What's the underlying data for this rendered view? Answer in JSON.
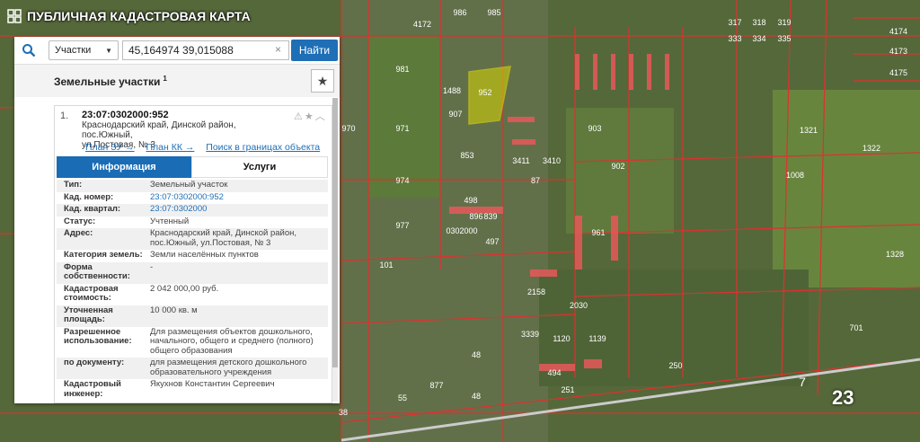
{
  "app": {
    "title": "ПУБЛИЧНАЯ КАДАСТРОВАЯ КАРТА"
  },
  "search": {
    "layer": "Участки",
    "value": "45,164974 39,015088",
    "clear": "×",
    "button": "Найти"
  },
  "panel": {
    "title": "Земельные участки",
    "count": "1",
    "fav_icon": "star-icon"
  },
  "result": {
    "index": "1.",
    "cad_number": "23:07:0302000:952",
    "address_l1": "Краснодарский край, Динской район, пос.Южный,",
    "address_l2": "ул.Постовая, № 3",
    "links": [
      "План ЗУ →",
      "План КК →",
      "Поиск в границах объекта →"
    ],
    "tabs": [
      "Информация",
      "Услуги"
    ],
    "props": [
      {
        "k": "Тип:",
        "v": "Земельный участок"
      },
      {
        "k": "Кад. номер:",
        "v": "23:07:0302000:952"
      },
      {
        "k": "Кад. квартал:",
        "v": "23:07:0302000"
      },
      {
        "k": "Статус:",
        "v": "Учтенный"
      },
      {
        "k": "Адрес:",
        "v": "Краснодарский край, Динской район, пос.Южный, ул.Постовая, № 3"
      },
      {
        "k": "Категория земель:",
        "v": "Земли населённых пунктов"
      },
      {
        "k": "Форма собственности:",
        "v": "-"
      },
      {
        "k": "Кадастровая стоимость:",
        "v": "2 042 000,00 руб."
      },
      {
        "k": "Уточненная площадь:",
        "v": "10 000 кв. м"
      },
      {
        "k": "Разрешенное использование:",
        "v": "Для размещения объектов дошкольного, начального, общего и среднего (полного) общего образования"
      },
      {
        "k": "по документу:",
        "v": "для размещения детского дошкольного образовательного учреждения"
      },
      {
        "k": "Кадастровый инженер:",
        "v": "Якухнов Константин Сергеевич"
      }
    ]
  },
  "map_labels": [
    "986",
    "985",
    "4172",
    "317",
    "318",
    "319",
    "333",
    "334",
    "335",
    "4174",
    "4173",
    "4175",
    "981",
    "952",
    "1488",
    "907",
    "971",
    "970",
    "903",
    "902",
    "1322",
    "1321",
    "1008",
    "853",
    "3411",
    "3410",
    "87",
    "498",
    "896",
    "839",
    "974",
    "977",
    "961",
    "1328",
    "0302000",
    "497",
    "101",
    "2158",
    "2030",
    "3339",
    "1120",
    "1139",
    "494",
    "251",
    "250",
    "877",
    "55",
    "48",
    "48",
    "38",
    "7",
    "23",
    "1008",
    "701"
  ],
  "labels_colors": {
    "parcel_line": "#e0302f",
    "selected": "#f2e600",
    "link": "#1f6fb6",
    "tab_active": "#1a6cb5"
  }
}
